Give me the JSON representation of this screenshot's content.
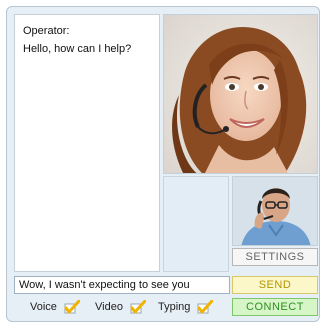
{
  "chat": {
    "operator_label": "Operator:",
    "message": "Hello, how can I help?"
  },
  "controls": {
    "settings_label": "SETTINGS",
    "input_value": "Wow, I wasn't expecting to see you",
    "send_label": "SEND",
    "connect_label": "CONNECT"
  },
  "options": {
    "voice_label": "Voice",
    "video_label": "Video",
    "typing_label": "Typing"
  },
  "colors": {
    "panel_bg": "#e7eff6",
    "send_bg": "#fbf7c8",
    "connect_bg": "#d7f6c8",
    "checkmark": "#f0b400"
  },
  "icons": {
    "voice_check": "checkmark-icon",
    "video_check": "checkmark-icon",
    "typing_check": "checkmark-icon"
  }
}
